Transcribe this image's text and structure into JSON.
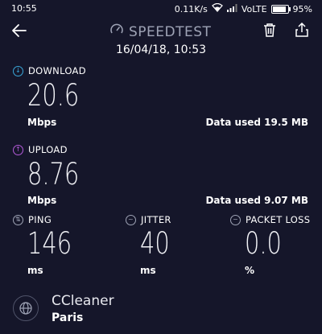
{
  "status_bar": {
    "time": "10:55",
    "network_speed": "0.11K/s",
    "network_type": "VoLTE",
    "battery": "95%",
    "battery_level": 0.95
  },
  "header": {
    "title": "SPEEDTEST",
    "timestamp": "16/04/18, 10:53",
    "icons": [
      "back-arrow-icon",
      "speedometer-icon",
      "trash-icon",
      "share-icon"
    ]
  },
  "download": {
    "label": "DOWNLOAD",
    "value": "20.6",
    "unit": "Mbps",
    "data_used": "Data used 19.5 MB",
    "icon_color": "#3aa7d9"
  },
  "upload": {
    "label": "UPLOAD",
    "value": "8.76",
    "unit": "Mbps",
    "data_used": "Data used 9.07 MB",
    "icon_color": "#b35ad9"
  },
  "ping": {
    "label": "PING",
    "value": "146",
    "unit": "ms"
  },
  "jitter": {
    "label": "JITTER",
    "value": "40",
    "unit": "ms"
  },
  "packet_loss": {
    "label": "PACKET LOSS",
    "value": "0.0",
    "unit": "%"
  },
  "server": {
    "name": "CCleaner",
    "city": "Paris"
  },
  "colors": {
    "background": "#15162a",
    "muted": "#9ea3b5"
  }
}
